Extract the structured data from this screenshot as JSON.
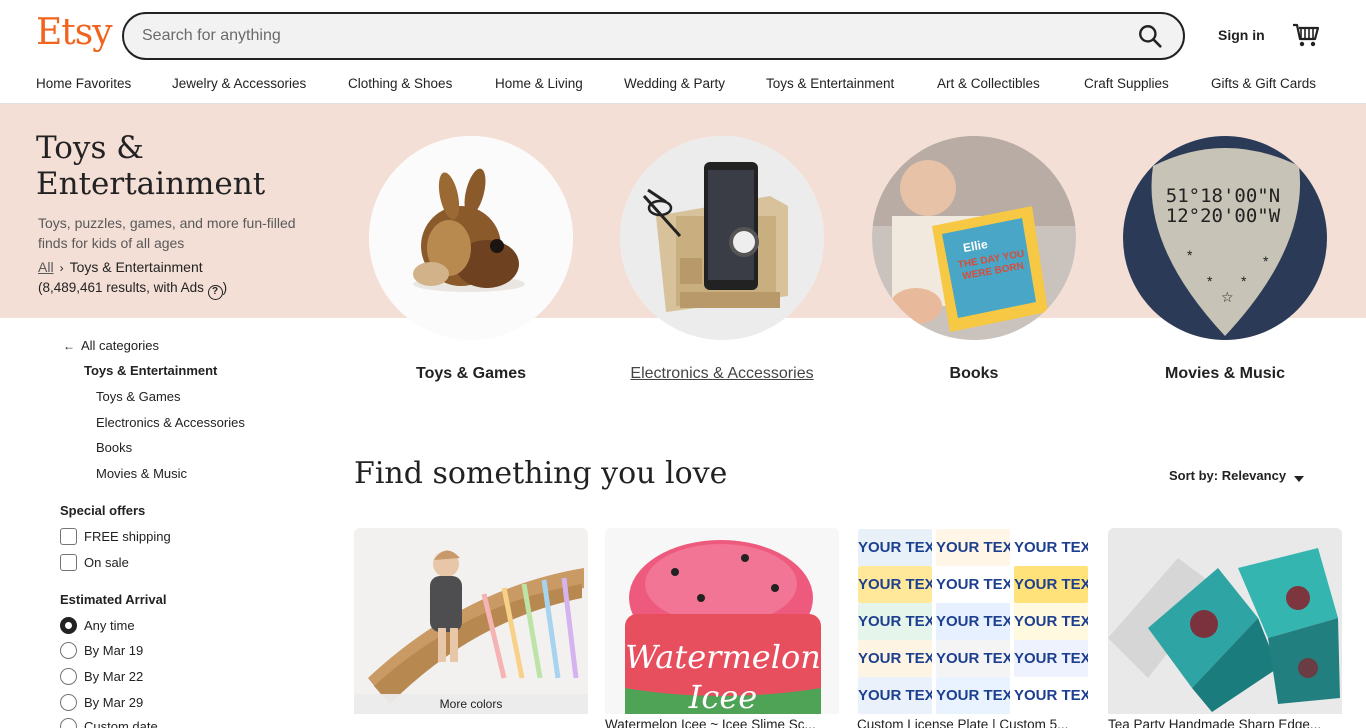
{
  "header": {
    "logo": "Etsy",
    "search_placeholder": "Search for anything",
    "search_value": "",
    "signin": "Sign in",
    "nav": [
      "Home Favorites",
      "Jewelry & Accessories",
      "Clothing & Shoes",
      "Home & Living",
      "Wedding & Party",
      "Toys & Entertainment",
      "Art & Collectibles",
      "Craft Supplies",
      "Gifts & Gift Cards"
    ]
  },
  "hero": {
    "title": "Toys & Entertainment",
    "description": "Toys, puzzles, games, and more fun-filled finds for kids of all ages",
    "breadcrumb_all": "All",
    "breadcrumb_current": "Toys & Entertainment",
    "results": "(8,489,461 results, with Ads",
    "results_close": ")",
    "categories": [
      {
        "label": "Toys & Games"
      },
      {
        "label": "Electronics & Accessories"
      },
      {
        "label": "Books"
      },
      {
        "label": "Movies & Music"
      }
    ],
    "guitar_pick_text_1": "51°18'00\"N",
    "guitar_pick_text_2": "12°20'00\"W",
    "book_title": "THE DAY YOU WERE BORN",
    "book_name": "Ellie"
  },
  "sidebar": {
    "all_categories": "All categories",
    "current": "Toys & Entertainment",
    "subcategories": [
      "Toys & Games",
      "Electronics & Accessories",
      "Books",
      "Movies & Music"
    ],
    "special_offers_heading": "Special offers",
    "special_offers": [
      "FREE shipping",
      "On sale"
    ],
    "arrival_heading": "Estimated Arrival",
    "arrival_options": [
      "Any time",
      "By Mar 19",
      "By Mar 22",
      "By Mar 29",
      "Custom date"
    ]
  },
  "main": {
    "title": "Find something you love",
    "sort_label": "Sort by: Relevancy",
    "listings": [
      {
        "title": "",
        "badge": "More colors"
      },
      {
        "title": "Watermelon Icee ~ Icee Slime Sc...",
        "product_text_1": "Watermelon",
        "product_text_2": "Icee"
      },
      {
        "title": "Custom License Plate | Custom 5...",
        "plate_text": "YOUR TEXT"
      },
      {
        "title": "Tea Party Handmade Sharp Edge..."
      }
    ]
  },
  "colors": {
    "brand": "#f1641e",
    "hero_bg": "#f4dfd7"
  }
}
